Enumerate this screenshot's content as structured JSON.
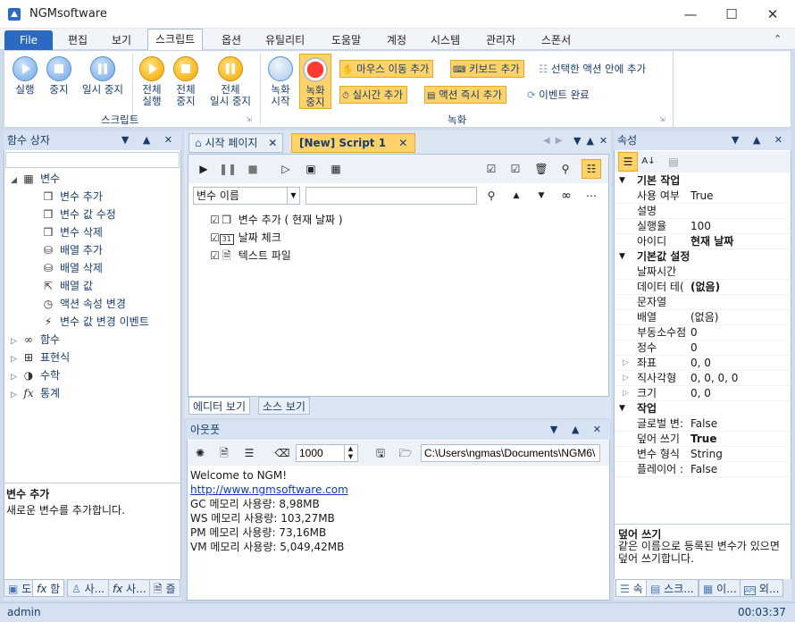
{
  "window": {
    "title": "NGMsoftware",
    "minimize_icon": "minimize-icon",
    "maximize_icon": "maximize-icon",
    "close_icon": "close-icon"
  },
  "menu": {
    "file": "File",
    "items": [
      "편집",
      "보기",
      "스크립트",
      "옵션",
      "유틸리티",
      "도움말",
      "계정",
      "시스템",
      "관리자",
      "스폰서"
    ]
  },
  "ribbon": {
    "script_group": {
      "label": "스크립트",
      "buttons": [
        {
          "label": "실행",
          "icon": "play-icon"
        },
        {
          "label": "중지",
          "icon": "stop-icon"
        },
        {
          "label": "일시 중지",
          "icon": "pause-icon"
        },
        {
          "label_line1": "전체",
          "label_line2": "실행",
          "icon": "play-all-icon"
        },
        {
          "label_line1": "전체",
          "label_line2": "중지",
          "icon": "stop-all-icon"
        },
        {
          "label_line1": "전체",
          "label_line2": "일시 중지",
          "icon": "pause-all-icon"
        }
      ]
    },
    "record_group": {
      "label": "녹화",
      "start_line1": "녹화",
      "start_line2": "시작",
      "stop_line1": "녹화",
      "stop_line2": "중지",
      "mouse_move": "마우스 이동 추가",
      "keyboard": "키보드 추가",
      "inside_action": "선택한 액션 안에 추가",
      "realtime": "실시간 추가",
      "action_now": "액션 즉시 추가",
      "event_done": "이벤트 완료"
    }
  },
  "function_box": {
    "title": "함수 상자",
    "search_placeholder": "",
    "tree": [
      {
        "label": "변수",
        "icon": "variable-group-icon",
        "expanded": true,
        "level": 0
      },
      {
        "label": "변수 추가",
        "icon": "cube-icon",
        "level": 1
      },
      {
        "label": "변수 값 수정",
        "icon": "cube-icon",
        "level": 1
      },
      {
        "label": "변수 삭제",
        "icon": "cube-icon",
        "level": 1
      },
      {
        "label": "배열 추가",
        "icon": "database-icon",
        "level": 1
      },
      {
        "label": "배열 삭제",
        "icon": "database-icon",
        "level": 1
      },
      {
        "label": "배열 값",
        "icon": "cursor-icon",
        "level": 1
      },
      {
        "label": "액션 속성 변경",
        "icon": "clock-icon",
        "level": 1
      },
      {
        "label": "변수 값 변경 이벤트",
        "icon": "lightning-icon",
        "level": 1
      },
      {
        "label": "함수",
        "icon": "infinity-icon",
        "expanded": false,
        "level": 0
      },
      {
        "label": "표현식",
        "icon": "grid-icon",
        "expanded": false,
        "level": 0
      },
      {
        "label": "수학",
        "icon": "pie-icon",
        "expanded": false,
        "level": 0
      },
      {
        "label": "통계",
        "icon": "fx-icon",
        "expanded": false,
        "level": 0
      }
    ],
    "desc_title": "변수 추가",
    "desc_text": "새로운 변수를 추가합니다.",
    "bottom_tabs": [
      "도",
      "함",
      "사...",
      "사...",
      "즐"
    ]
  },
  "editor": {
    "tabs": [
      {
        "label": "시작 페이지",
        "icon": "home-icon"
      },
      {
        "label": "[New] Script 1",
        "active": true
      }
    ],
    "combo_value": "변수 이름",
    "search_value": "",
    "items": [
      {
        "label": "변수 추가 ( 현재 날짜 )",
        "checked": true,
        "icon": "cube-icon"
      },
      {
        "label": "날짜 체크",
        "checked": true,
        "icon": "calendar-icon"
      },
      {
        "label": "텍스트 파일",
        "checked": true,
        "icon": "file-lock-icon"
      }
    ],
    "calendar_day": "31",
    "bottom_tabs": [
      "에디터 보기",
      "소스 보기"
    ]
  },
  "output": {
    "title": "아웃풋",
    "count_value": "1000",
    "path_value": "C:\\Users\\ngmas\\Documents\\NGM6\\",
    "lines": [
      {
        "text": "Welcome to NGM!"
      },
      {
        "text": "http://www.ngmsoftware.com",
        "link": true
      },
      {
        "text": "GC 메모리 사용량: 8,98MB"
      },
      {
        "text": "WS 메모리 사용량: 103,27MB"
      },
      {
        "text": "PM 메모리 사용량: 73,16MB"
      },
      {
        "text": "VM 메모리 사용량: 5,049,42MB"
      }
    ]
  },
  "properties": {
    "title": "속성",
    "rows": [
      {
        "type": "cat",
        "name": "기본 작업"
      },
      {
        "name": "사용 여부",
        "value": "True"
      },
      {
        "name": "설명",
        "value": ""
      },
      {
        "name": "실행율",
        "value": "100"
      },
      {
        "name": "아이디",
        "value": "현재 날짜",
        "bold": true
      },
      {
        "type": "cat",
        "name": "기본값 설정"
      },
      {
        "name": "날짜시간",
        "value": ""
      },
      {
        "name": "데이터 테(",
        "value": "(없음)",
        "bold": true
      },
      {
        "name": "문자열",
        "value": ""
      },
      {
        "name": "배열",
        "value": "(없음)"
      },
      {
        "name": "부동소수점",
        "value": "0"
      },
      {
        "name": "정수",
        "value": "0"
      },
      {
        "name": "좌표",
        "value": "0, 0",
        "expand": true
      },
      {
        "name": "직사각형",
        "value": "0, 0, 0, 0",
        "expand": true
      },
      {
        "name": "크기",
        "value": "0, 0",
        "expand": true
      },
      {
        "type": "cat",
        "name": "작업"
      },
      {
        "name": "글로벌 변:",
        "value": "False"
      },
      {
        "name": "덮어 쓰기",
        "value": "True",
        "bold": true
      },
      {
        "name": "변수 형식",
        "value": "String"
      },
      {
        "name": "플레이어 :",
        "value": "False"
      }
    ],
    "desc_title": "덮어 쓰기",
    "desc_text": "같은 이름으로 등록된 변수가 있으면 덮어 쓰기합니다.",
    "bottom_tabs": [
      "속",
      "스크...",
      "이...",
      "외..."
    ]
  },
  "status": {
    "user": "admin",
    "time": "00:03:37"
  },
  "colors": {
    "accent": "#2b6ac0",
    "highlight": "#ffd36a",
    "panel_head": "#d7e3f2"
  }
}
